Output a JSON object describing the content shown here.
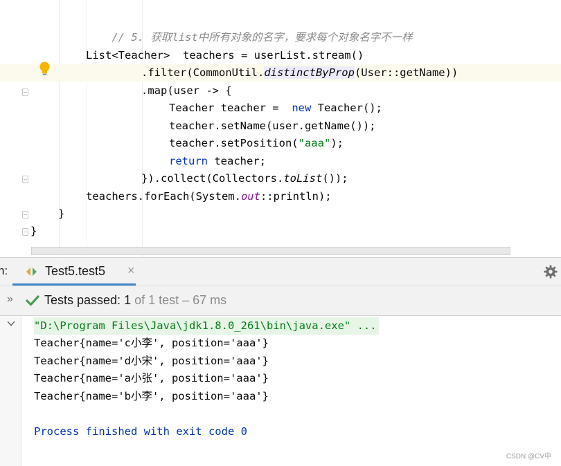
{
  "editor": {
    "comment": "// 5. 获取list中所有对象的名字，要求每个对象名字不一样",
    "code": {
      "l1_type": "List<Teacher>",
      "l1_rest": "  teachers = userList.stream()",
      "l2_a": ".filter(CommonUtil.",
      "l2_method": "distinctByProp",
      "l2_b": "(User::getName))",
      "l3": ".map(user -> {",
      "l4_a": "Teacher teacher =  ",
      "l4_kw": "new",
      "l4_b": " Teacher();",
      "l5": "teacher.setName(user.getName());",
      "l6_a": "teacher.setPosition(",
      "l6_str": "\"aaa\"",
      "l6_b": ");",
      "l7_kw": "return",
      "l7_b": " teacher;",
      "l8_a": "}).collect(Collectors.",
      "l8_method": "toList",
      "l8_b": "());",
      "l9_a": "teachers.forEach(System.",
      "l9_field": "out",
      "l9_b": "::println);",
      "l10": "}",
      "l11": "}"
    }
  },
  "run_panel": {
    "label": "n:",
    "tab_label": "Test5.test5",
    "tab_close": "×",
    "expand_glyph": "»",
    "test_status": {
      "passed_label": "Tests passed: ",
      "count": "1",
      "detail": " of 1 test – 67 ms"
    },
    "console": {
      "command": "\"D:\\Program Files\\Java\\jdk1.8.0_261\\bin\\java.exe\" ...",
      "lines": [
        "Teacher{name='c小李', position='aaa'}",
        "Teacher{name='d小宋', position='aaa'}",
        "Teacher{name='a小张', position='aaa'}",
        "Teacher{name='b小李', position='aaa'}"
      ],
      "exit": "Process finished with exit code 0"
    }
  },
  "watermark": "CSDN @CV中",
  "colors": {
    "keyword": "#0033b3",
    "string": "#067d17",
    "comment": "#8c8c8c",
    "accent": "#4083c9",
    "success": "#499c54"
  },
  "icons": [
    "lightbulb-icon",
    "fold-marker-icon",
    "run-config-icon",
    "gear-icon",
    "expand-icon",
    "checkmark-icon",
    "collapse-icon"
  ]
}
